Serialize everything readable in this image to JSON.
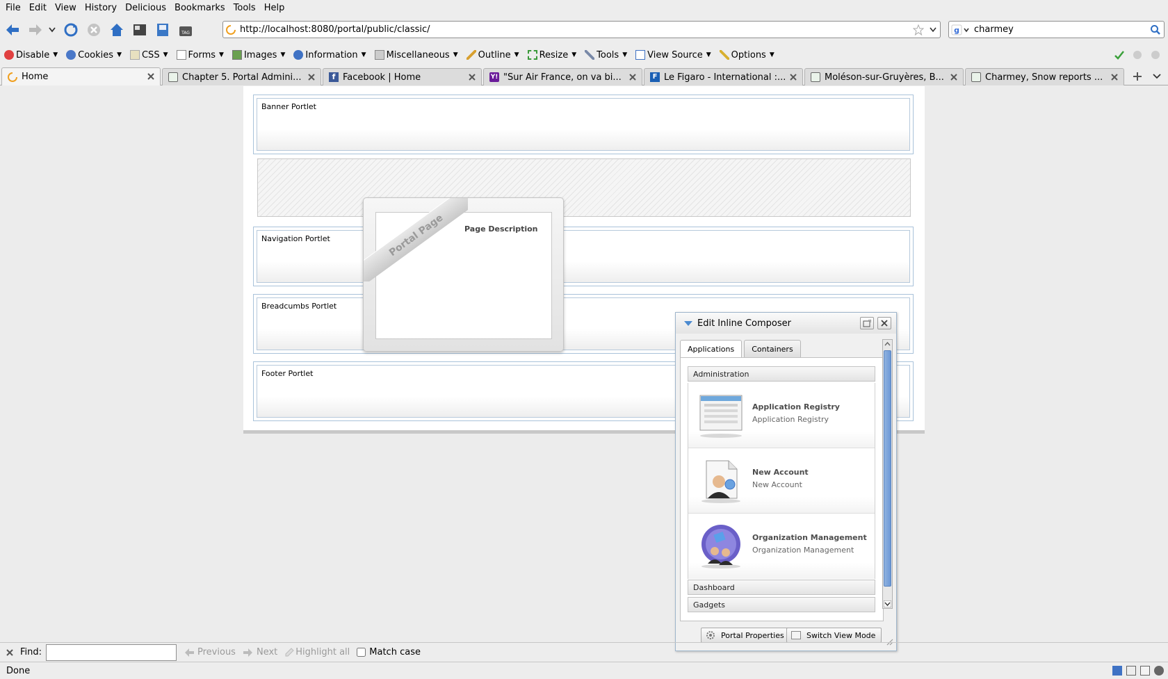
{
  "menubar": {
    "items": [
      "File",
      "Edit",
      "View",
      "History",
      "Delicious",
      "Bookmarks",
      "Tools",
      "Help"
    ]
  },
  "navbar": {
    "url": "http://localhost:8080/portal/public/classic/",
    "search_value": "charmey"
  },
  "devbar": {
    "items": [
      "Disable",
      "Cookies",
      "CSS",
      "Forms",
      "Images",
      "Information",
      "Miscellaneous",
      "Outline",
      "Resize",
      "Tools",
      "View Source",
      "Options"
    ]
  },
  "tabs": [
    {
      "label": "Home"
    },
    {
      "label": "Chapter 5. Portal Admini..."
    },
    {
      "label": "Facebook | Home"
    },
    {
      "label": "\"Sur Air France, on va bi..."
    },
    {
      "label": "Le Figaro - International :..."
    },
    {
      "label": "Moléson-sur-Gruyères, B..."
    },
    {
      "label": "Charmey, Snow reports ..."
    }
  ],
  "page": {
    "portlets": [
      "Banner Portlet",
      "Navigation Portlet",
      "Breadcumbs Portlet",
      "Footer Portlet"
    ],
    "portal_page": {
      "ribbon": "Portal Page",
      "description": "Page Description"
    }
  },
  "composer": {
    "title": "Edit Inline Composer",
    "tabs": [
      "Applications",
      "Containers"
    ],
    "categories": {
      "administration": "Administration",
      "dashboard": "Dashboard",
      "gadgets": "Gadgets"
    },
    "apps": [
      {
        "name": "Application Registry",
        "description": "Application Registry"
      },
      {
        "name": "New Account",
        "description": "New Account"
      },
      {
        "name": "Organization Management",
        "description": "Organization Management"
      }
    ],
    "footer": {
      "portal_properties": "Portal Properties",
      "switch_view_mode": "Switch View Mode"
    }
  },
  "findbar": {
    "label": "Find:",
    "value": "",
    "previous": "Previous",
    "next": "Next",
    "highlight_all": "Highlight all",
    "match_case": "Match case"
  },
  "status": {
    "text": "Done"
  },
  "colors": {
    "accent": "#4b8ad0",
    "portlet_border": "#a9c2da"
  }
}
